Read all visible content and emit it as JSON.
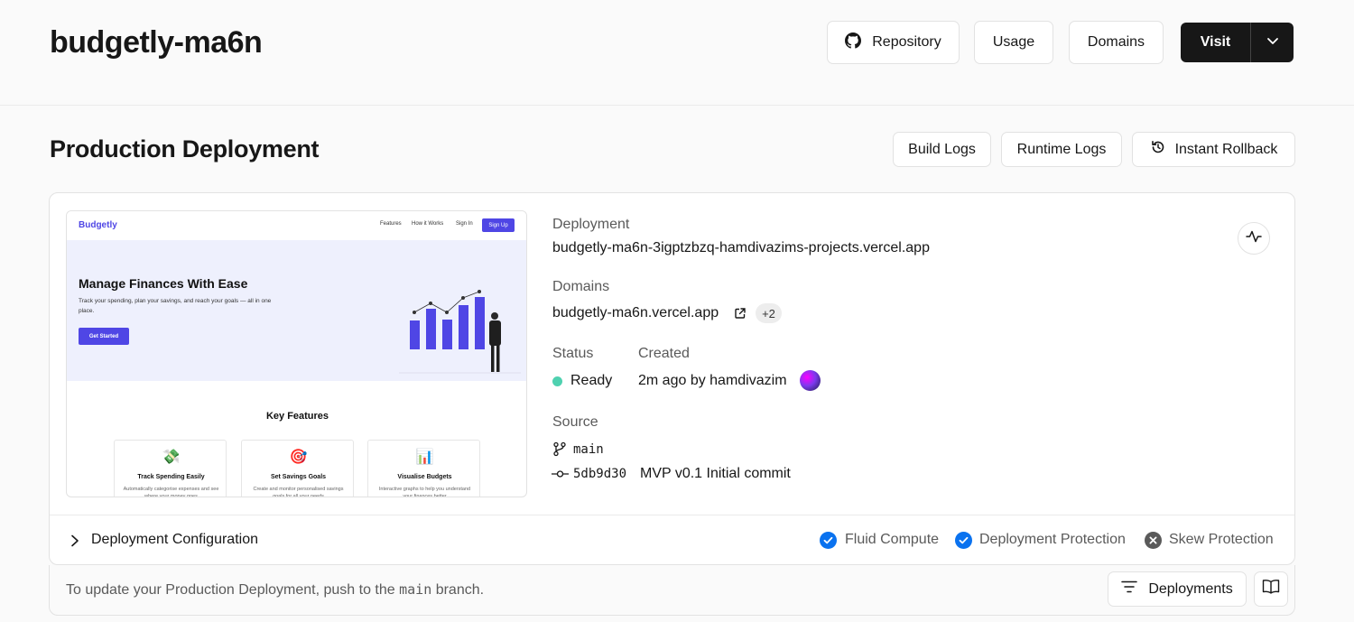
{
  "header": {
    "project_name": "budgetly-ma6n",
    "repository_label": "Repository",
    "usage_label": "Usage",
    "domains_label": "Domains",
    "visit_label": "Visit"
  },
  "section": {
    "title": "Production Deployment",
    "build_logs_label": "Build Logs",
    "runtime_logs_label": "Runtime Logs",
    "rollback_label": "Instant Rollback"
  },
  "preview": {
    "brand": "Budgetly",
    "nav": [
      "Features",
      "How it Works",
      "Sign In"
    ],
    "signup": "Sign Up",
    "hero_title": "Manage Finances With Ease",
    "hero_sub": "Track your spending, plan your savings, and reach your goals — all in one place.",
    "cta": "Get Started",
    "key_title": "Key Features",
    "features": [
      {
        "emoji": "💸",
        "title": "Track Spending Easily",
        "desc": "Automatically categorise expenses and see where your money goes"
      },
      {
        "emoji": "🎯",
        "title": "Set Savings Goals",
        "desc": "Create and monitor personalised savings goals for all your needs"
      },
      {
        "emoji": "📊",
        "title": "Visualise Budgets",
        "desc": "Interactive graphs to help you understand your finances better"
      }
    ]
  },
  "deployment": {
    "deployment_label": "Deployment",
    "deployment_url": "budgetly-ma6n-3igptzbzq-hamdivazims-projects.vercel.app",
    "domains_label": "Domains",
    "domain": "budgetly-ma6n.vercel.app",
    "extra_domains": "+2",
    "status_label": "Status",
    "status": "Ready",
    "status_color": "#4fd1b0",
    "created_label": "Created",
    "created": "2m ago by hamdivazim",
    "source_label": "Source",
    "branch": "main",
    "commit_hash": "5db9d30",
    "commit_message": "MVP v0.1 Initial commit"
  },
  "config": {
    "title": "Deployment Configuration",
    "fluid_compute": "Fluid Compute",
    "deployment_protection": "Deployment Protection",
    "skew_protection": "Skew Protection",
    "check_color": "#0a72ef"
  },
  "footer": {
    "text_before": "To update your Production Deployment, push to the",
    "branch": "main",
    "text_after": "branch.",
    "deployments_label": "Deployments"
  }
}
